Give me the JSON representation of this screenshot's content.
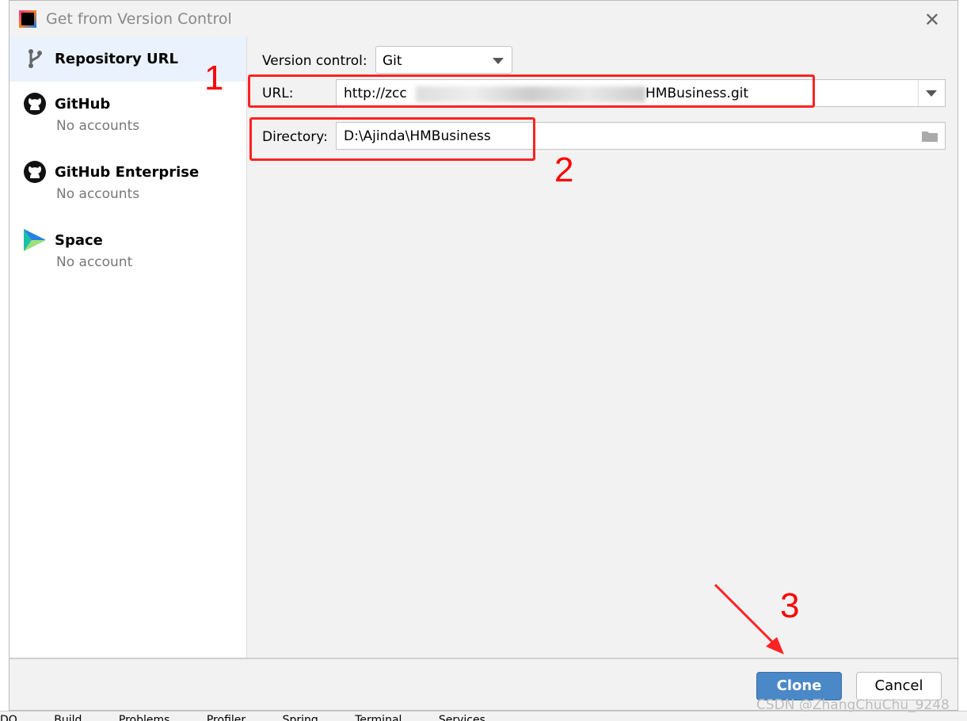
{
  "dialog": {
    "title": "Get from Version Control",
    "close_icon": "close-icon"
  },
  "sidebar": {
    "items": [
      {
        "label": "Repository URL",
        "icon": "branch-icon"
      },
      {
        "label": "GitHub",
        "sub": "No accounts",
        "icon": "github-icon"
      },
      {
        "label": "GitHub Enterprise",
        "sub": "No accounts",
        "icon": "github-icon"
      },
      {
        "label": "Space",
        "sub": "No account",
        "icon": "space-icon"
      }
    ]
  },
  "form": {
    "vc_label": "Version control:",
    "vc_value": "Git",
    "url_label": "URL:",
    "url_start": "http://zcc",
    "url_end": "HMBusiness.git",
    "dir_label": "Directory:",
    "dir_value": "D:\\Ajinda\\HMBusiness"
  },
  "buttons": {
    "clone": "Clone",
    "cancel": "Cancel"
  },
  "annotations": {
    "n1": "1",
    "n2": "2",
    "n3": "3",
    "color": "#ff2222"
  },
  "watermark": "CSDN @ZhangChuChu_9248",
  "bottombar": [
    "DO",
    "Build",
    "Problems",
    "Profiler",
    "Spring",
    "Terminal",
    "Services"
  ]
}
